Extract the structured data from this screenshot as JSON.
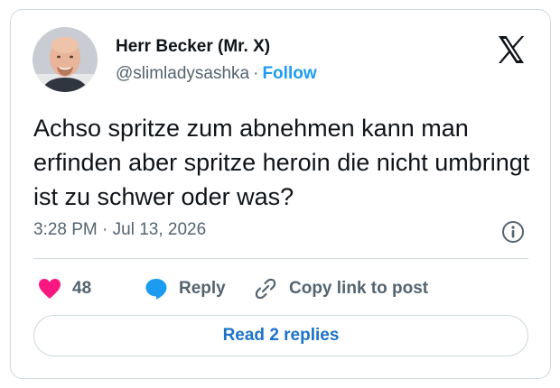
{
  "author": {
    "name": "Herr Becker (Mr. X)",
    "handle": "@slimladysashka",
    "separator": "·",
    "follow_label": "Follow"
  },
  "tweet": {
    "text": "Achso spritze zum abnehmen kann man erfinden aber spritze heroin die nicht umbringt ist zu schwer oder was?",
    "timestamp": "3:28 PM · Jul 13, 2026"
  },
  "actions": {
    "likes_count": "48",
    "reply_label": "Reply",
    "copy_link_label": "Copy link to post"
  },
  "read_replies_label": "Read 2 replies",
  "colors": {
    "accent": "#1d9bf0",
    "like": "#f91880",
    "border": "#cfd9de",
    "secondary_text": "#536471"
  },
  "icons": [
    "x-logo-icon",
    "info-icon",
    "heart-icon",
    "speech-bubble-icon",
    "link-icon"
  ]
}
